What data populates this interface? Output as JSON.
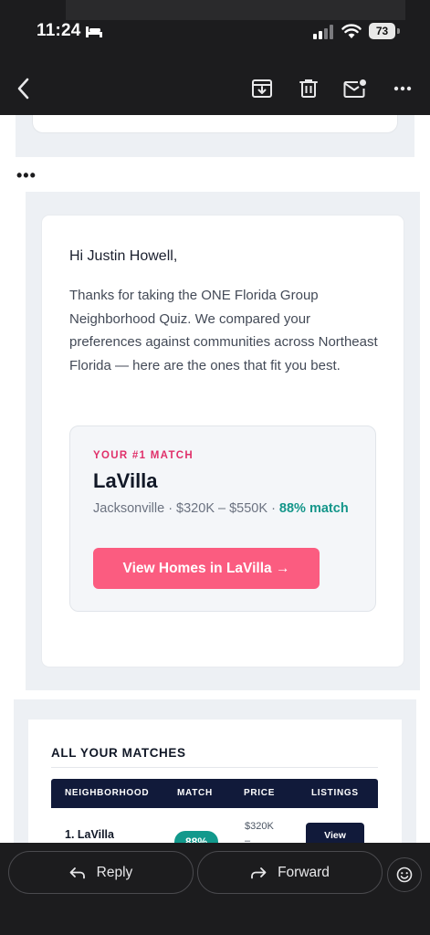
{
  "status_bar": {
    "time": "11:24",
    "battery": "73",
    "icons": [
      "bed-icon",
      "signal-icon",
      "wifi-icon",
      "battery-icon"
    ]
  },
  "toolbar": {
    "icons": [
      "back-chevron-icon",
      "archive-icon",
      "trash-icon",
      "mail-unread-icon",
      "more-icon"
    ]
  },
  "thread": {
    "collapsed_marker": "•••"
  },
  "email": {
    "greeting": "Hi Justin Howell,",
    "intro": "Thanks for taking the ONE Florida Group Neighborhood Quiz. We compared your preferences against communities across Northeast Florida — here are the ones that fit you best.",
    "top_match": {
      "eyebrow": "YOUR #1 MATCH",
      "name": "LaVilla",
      "meta": "Jacksonville · $320K – $550K · ",
      "percent_text": "88% match",
      "cta_label": "View Homes in LaVilla →"
    },
    "all_matches": {
      "title": "ALL YOUR MATCHES",
      "columns": [
        "NEIGHBORHOOD",
        "MATCH",
        "PRICE",
        "LISTINGS"
      ],
      "rows": [
        {
          "name": "1. LaVilla",
          "match": "88%",
          "price": "$320K\n–",
          "action": "View"
        }
      ]
    }
  },
  "bottom_bar": {
    "reply_label": "Reply",
    "forward_label": "Forward",
    "icons": [
      "reply-icon",
      "forward-icon",
      "emoji-icon"
    ]
  },
  "colors": {
    "accent_pink": "#e0306a",
    "cta_pink": "#fb5c80",
    "match_teal": "#14968a",
    "navy": "#111a3a"
  }
}
